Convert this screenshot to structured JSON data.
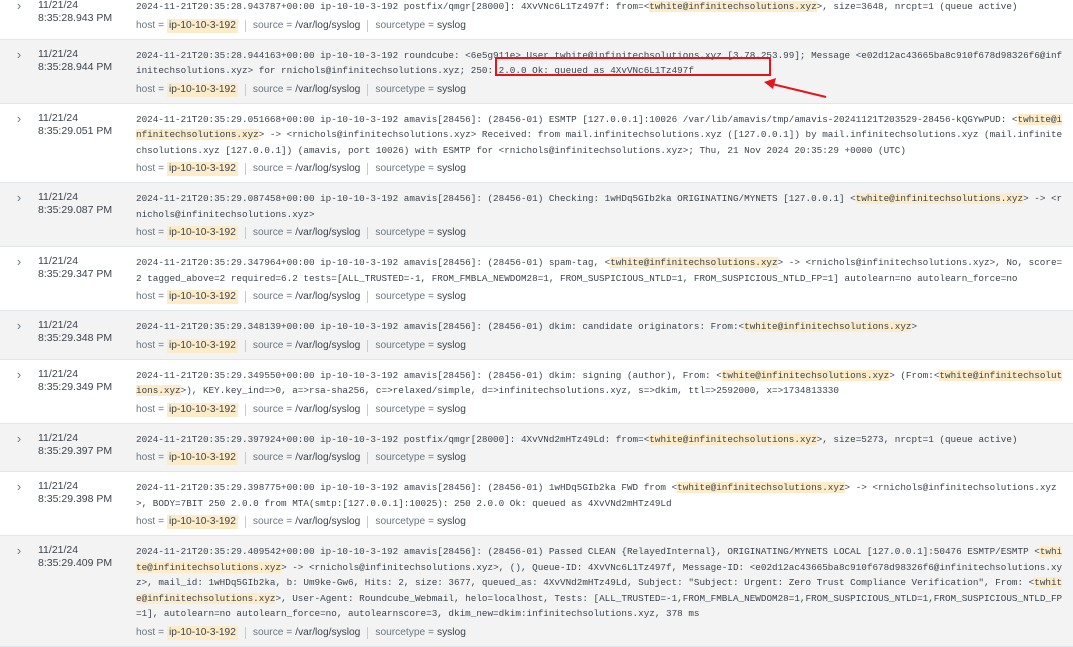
{
  "field_labels": {
    "host": "host =",
    "source": "source =",
    "sourcetype": "sourcetype ="
  },
  "annotation_color": "#e8141b",
  "highlight_color": "#fcecc9",
  "events": [
    {
      "date": "11/21/24",
      "time": "8:35:28.943 PM",
      "segments": [
        {
          "t": "2024-11-21T20:35:28.943787+00:00 ip-10-10-3-192 postfix/qmgr[28000]: 4XvVNc6L1Tz497f: from=<"
        },
        {
          "t": "twhite@infinitechsolutions.xyz",
          "hl": true
        },
        {
          "t": ">, size=3648, nrcpt=1 (queue active)"
        }
      ],
      "host": "ip-10-10-3-192",
      "source": "/var/log/syslog",
      "sourcetype": "syslog"
    },
    {
      "date": "11/21/24",
      "time": "8:35:28.944 PM",
      "segments": [
        {
          "t": "2024-11-21T20:35:28.944163+00:00 ip-10-10-3-192 roundcube: <6e5g911e> User twhite@infinitechsolutions.xyz [3.78.253.99]; Message <e02d12ac43665ba8c910f678d98326f6@infinitechsolutions.xyz> for rnichols@infinitechsolutions.xyz; 250: 2.0.0 Ok: queued as 4XvVNc6L1Tz497f"
        }
      ],
      "host": "ip-10-10-3-192",
      "source": "/var/log/syslog",
      "sourcetype": "syslog"
    },
    {
      "date": "11/21/24",
      "time": "8:35:29.051 PM",
      "segments": [
        {
          "t": "2024-11-21T20:35:29.051668+00:00 ip-10-10-3-192 amavis[28456]: (28456-01) ESMTP [127.0.0.1]:10026 /var/lib/amavis/tmp/amavis-20241121T203529-28456-kQGYwPUD: <"
        },
        {
          "t": "twhite@infinitechsolutions.xyz",
          "hl": true
        },
        {
          "t": "> -> <rnichols@infinitechsolutions.xyz> Received: from mail.infinitechsolutions.xyz ([127.0.0.1]) by mail.infinitechsolutions.xyz (mail.infinitechsolutions.xyz [127.0.0.1]) (amavis, port 10026) with ESMTP for <rnichols@infinitechsolutions.xyz>; Thu, 21 Nov 2024 20:35:29 +0000 (UTC)"
        }
      ],
      "host": "ip-10-10-3-192",
      "source": "/var/log/syslog",
      "sourcetype": "syslog"
    },
    {
      "date": "11/21/24",
      "time": "8:35:29.087 PM",
      "segments": [
        {
          "t": "2024-11-21T20:35:29.087458+00:00 ip-10-10-3-192 amavis[28456]: (28456-01) Checking: 1wHDq5GIb2ka ORIGINATING/MYNETS [127.0.0.1] <"
        },
        {
          "t": "twhite@infinitechsolutions.xyz",
          "hl": true
        },
        {
          "t": "> -> <rnichols@infinitechsolutions.xyz>"
        }
      ],
      "host": "ip-10-10-3-192",
      "source": "/var/log/syslog",
      "sourcetype": "syslog"
    },
    {
      "date": "11/21/24",
      "time": "8:35:29.347 PM",
      "segments": [
        {
          "t": "2024-11-21T20:35:29.347964+00:00 ip-10-10-3-192 amavis[28456]: (28456-01) spam-tag, <"
        },
        {
          "t": "twhite@infinitechsolutions.xyz",
          "hl": true
        },
        {
          "t": "> -> <rnichols@infinitechsolutions.xyz>, No, score=2 tagged_above=2 required=6.2 tests=[ALL_TRUSTED=-1, FROM_FMBLA_NEWDOM28=1, FROM_SUSPICIOUS_NTLD=1, FROM_SUSPICIOUS_NTLD_FP=1] autolearn=no autolearn_force=no"
        }
      ],
      "host": "ip-10-10-3-192",
      "source": "/var/log/syslog",
      "sourcetype": "syslog"
    },
    {
      "date": "11/21/24",
      "time": "8:35:29.348 PM",
      "segments": [
        {
          "t": "2024-11-21T20:35:29.348139+00:00 ip-10-10-3-192 amavis[28456]: (28456-01) dkim: candidate originators: From:<"
        },
        {
          "t": "twhite@infinitechsolutions.xyz",
          "hl": true
        },
        {
          "t": ">"
        }
      ],
      "host": "ip-10-10-3-192",
      "source": "/var/log/syslog",
      "sourcetype": "syslog"
    },
    {
      "date": "11/21/24",
      "time": "8:35:29.349 PM",
      "segments": [
        {
          "t": "2024-11-21T20:35:29.349550+00:00 ip-10-10-3-192 amavis[28456]: (28456-01) dkim: signing (author), From: <"
        },
        {
          "t": "twhite@infinitechsolutions.xyz",
          "hl": true
        },
        {
          "t": "> (From:<"
        },
        {
          "t": "twhite@infinitechsolutions.xyz",
          "hl": true
        },
        {
          "t": ">), KEY.key_ind=>0, a=>rsa-sha256, c=>relaxed/simple, d=>infinitechsolutions.xyz, s=>dkim, ttl=>2592000, x=>1734813330"
        }
      ],
      "host": "ip-10-10-3-192",
      "source": "/var/log/syslog",
      "sourcetype": "syslog"
    },
    {
      "date": "11/21/24",
      "time": "8:35:29.397 PM",
      "segments": [
        {
          "t": "2024-11-21T20:35:29.397924+00:00 ip-10-10-3-192 postfix/qmgr[28000]: 4XvVNd2mHTz49Ld: from=<"
        },
        {
          "t": "twhite@infinitechsolutions.xyz",
          "hl": true
        },
        {
          "t": ">, size=5273, nrcpt=1 (queue active)"
        }
      ],
      "host": "ip-10-10-3-192",
      "source": "/var/log/syslog",
      "sourcetype": "syslog"
    },
    {
      "date": "11/21/24",
      "time": "8:35:29.398 PM",
      "segments": [
        {
          "t": "2024-11-21T20:35:29.398775+00:00 ip-10-10-3-192 amavis[28456]: (28456-01) 1wHDq5GIb2ka FWD from <"
        },
        {
          "t": "twhite@infinitechsolutions.xyz",
          "hl": true
        },
        {
          "t": "> -> <rnichols@infinitechsolutions.xyz>, BODY=7BIT 250 2.0.0 from MTA(smtp:[127.0.0.1]:10025): 250 2.0.0 Ok: queued as 4XvVNd2mHTz49Ld"
        }
      ],
      "host": "ip-10-10-3-192",
      "source": "/var/log/syslog",
      "sourcetype": "syslog"
    },
    {
      "date": "11/21/24",
      "time": "8:35:29.409 PM",
      "segments": [
        {
          "t": "2024-11-21T20:35:29.409542+00:00 ip-10-10-3-192 amavis[28456]: (28456-01) Passed CLEAN {RelayedInternal}, ORIGINATING/MYNETS LOCAL [127.0.0.1]:50476 ESMTP/ESMTP <"
        },
        {
          "t": "twhite@infinitechsolutions.xyz",
          "hl": true
        },
        {
          "t": "> -> <rnichols@infinitechsolutions.xyz>, (), Queue-ID: 4XvVNc6L1Tz497f, Message-ID: <e02d12ac43665ba8c910f678d98326f6@infinitechsolutions.xyz>, mail_id: 1wHDq5GIb2ka, b: Um9ke-Gw6, Hits: 2, size: 3677, queued_as: 4XvVNd2mHTz49Ld, Subject: \"Subject: Urgent: Zero Trust Compliance Verification\", From: <"
        },
        {
          "t": "twhite@infinitechsolutions.xyz",
          "hl": true
        },
        {
          "t": ">, User-Agent: Roundcube_Webmail, helo=localhost, Tests: [ALL_TRUSTED=-1,FROM_FMBLA_NEWDOM28=1,FROM_SUSPICIOUS_NTLD=1,FROM_SUSPICIOUS_NTLD_FP=1], autolearn=no autolearn_force=no, autolearnscore=3, dkim_new=dkim:infinitechsolutions.xyz, 378 ms"
        }
      ],
      "host": "ip-10-10-3-192",
      "source": "/var/log/syslog",
      "sourcetype": "syslog"
    }
  ]
}
